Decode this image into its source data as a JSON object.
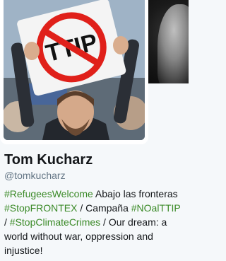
{
  "profile": {
    "name": "Tom Kucharz",
    "handle": "@tomkucharz",
    "avatar_sign_text": "TTIP",
    "bio": [
      {
        "type": "hashtag",
        "text": "#RefugeesWelcome"
      },
      {
        "type": "text",
        "text": " Abajo las fronteras "
      },
      {
        "type": "hashtag",
        "text": "#StopFRONTEX"
      },
      {
        "type": "text",
        "text": " / Campaña "
      },
      {
        "type": "hashtag",
        "text": "#NOalTTIP"
      },
      {
        "type": "text",
        "text": " / "
      },
      {
        "type": "hashtag",
        "text": "#StopClimateCrimes"
      },
      {
        "type": "text",
        "text": " / Our dream: a world without war, oppression and injustice!"
      }
    ]
  },
  "colors": {
    "background": "#f5f8fa",
    "hashtag": "#3b8a28",
    "name": "#14171a",
    "handle": "#657786",
    "sign_red": "#e0201a"
  }
}
